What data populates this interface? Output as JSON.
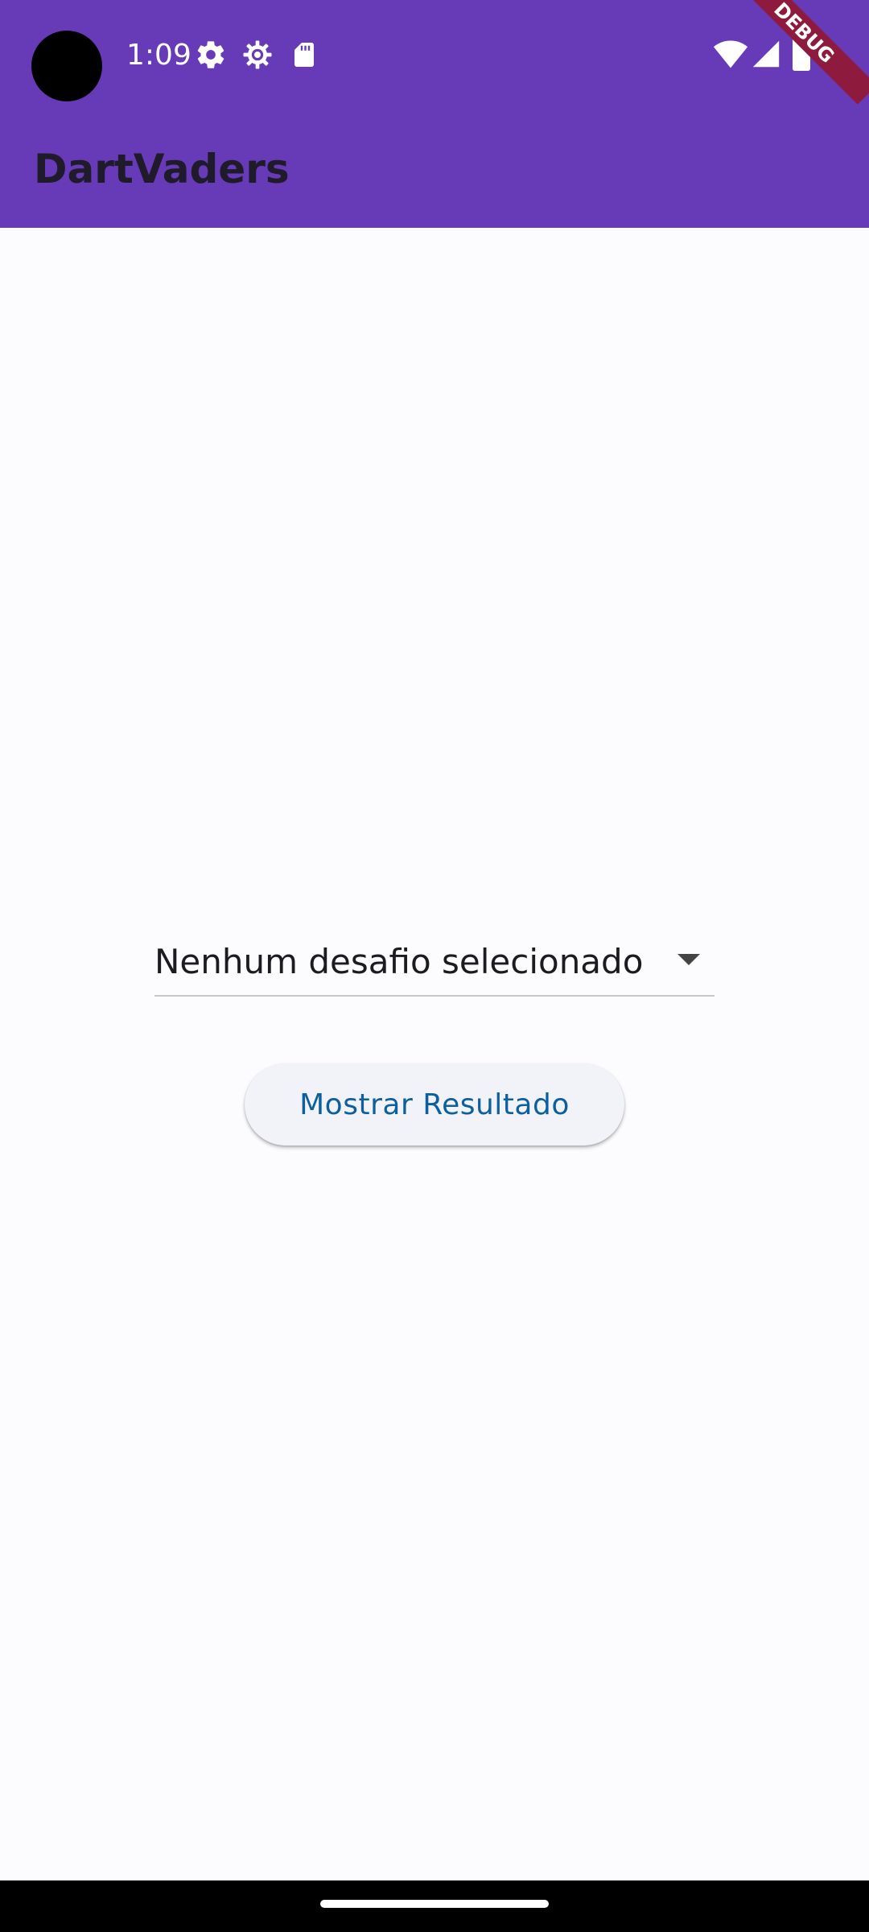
{
  "status_bar": {
    "time": "1:09",
    "icons": [
      "settings-icon",
      "settings-gear-icon",
      "sd-card-icon",
      "wifi-icon",
      "cellular-signal-icon",
      "battery-icon"
    ]
  },
  "app_bar": {
    "title": "DartVaders",
    "background_color": "#673AB7",
    "debug_banner": "DEBUG"
  },
  "main": {
    "dropdown": {
      "selected": "Nenhum desafio selecionado",
      "icon": "arrow-drop-down-icon"
    },
    "action_button": {
      "label": "Mostrar Resultado",
      "color": "#0D5F9E"
    }
  },
  "nav_bar": {
    "handle": "home-gesture-handle"
  }
}
